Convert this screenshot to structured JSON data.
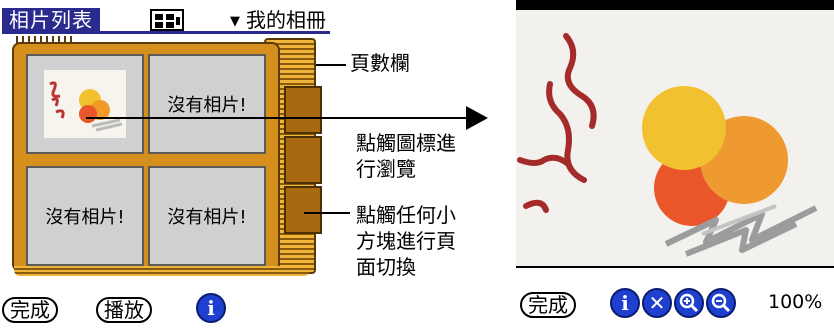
{
  "left_screen": {
    "title": "相片列表",
    "album_dropdown": "我的相冊",
    "empty_slot_text": "沒有相片!",
    "buttons": {
      "done": "完成",
      "play": "播放"
    },
    "icons": [
      "list-view-icon",
      "dropdown-triangle-icon",
      "info-icon"
    ]
  },
  "callouts": {
    "page_bar": "頁數欄",
    "tap_icon_line1": "點觸圖標進",
    "tap_icon_line2": "行瀏覽",
    "tap_block_line1": "點觸任何小",
    "tap_block_line2": "方塊進行頁",
    "tap_block_line3": "面切換"
  },
  "right_screen": {
    "buttons": {
      "done": "完成"
    },
    "toolbar_icons": [
      "info-icon",
      "delete-icon",
      "zoom-in-icon",
      "zoom-out-icon"
    ],
    "zoom": "100%"
  },
  "colors": {
    "title_bar": "#2b2a8f",
    "album_wood": "#d58f1c",
    "button_blue": "#1f3fd0"
  }
}
